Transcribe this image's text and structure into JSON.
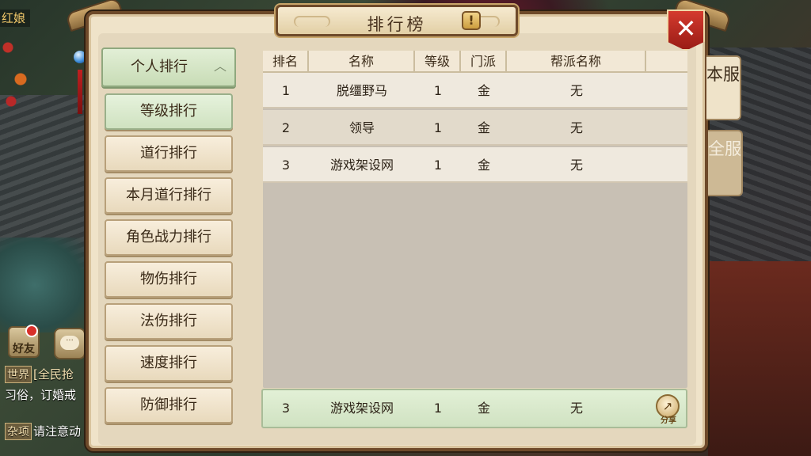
{
  "background": {
    "npc_name": "红娘"
  },
  "hud": {
    "friend_label": "好友",
    "chat_label": "···",
    "chat_lines": [
      {
        "tag": "世界",
        "text": "[全民抢"
      },
      {
        "tag": "",
        "text": "习俗，订婚戒"
      },
      {
        "tag": "杂项",
        "text": "请注意动"
      }
    ]
  },
  "panel": {
    "title": "排行榜",
    "info_icon": "!",
    "close_label": "✕"
  },
  "categories": {
    "header": "个人排行",
    "items": [
      {
        "label": "等级排行",
        "active": true
      },
      {
        "label": "道行排行",
        "active": false
      },
      {
        "label": "本月道行排行",
        "active": false
      },
      {
        "label": "角色战力排行",
        "active": false
      },
      {
        "label": "物伤排行",
        "active": false
      },
      {
        "label": "法伤排行",
        "active": false
      },
      {
        "label": "速度排行",
        "active": false
      },
      {
        "label": "防御排行",
        "active": false
      }
    ]
  },
  "table": {
    "columns": [
      "排名",
      "名称",
      "等级",
      "门派",
      "帮派名称"
    ],
    "rows": [
      {
        "rank": "1",
        "name": "脱缰野马",
        "level": "1",
        "faction": "金",
        "guild": "无"
      },
      {
        "rank": "2",
        "name": "领导",
        "level": "1",
        "faction": "金",
        "guild": "无"
      },
      {
        "rank": "3",
        "name": "游戏架设网",
        "level": "1",
        "faction": "金",
        "guild": "无"
      }
    ]
  },
  "my_rank": {
    "rank": "3",
    "name": "游戏架设网",
    "level": "1",
    "faction": "金",
    "guild": "无",
    "share_label": "分享"
  },
  "side_tabs": {
    "server": "本服",
    "all": "全服"
  },
  "colors": {
    "panel_bg": "#efe3c9",
    "frame_brown": "#6e4a2a",
    "active_green": "#cfe2c0",
    "close_red": "#c0281f"
  },
  "icons": [
    "info-icon",
    "close-icon",
    "chevron-up-icon",
    "share-icon",
    "friend-icon",
    "chat-icon"
  ]
}
